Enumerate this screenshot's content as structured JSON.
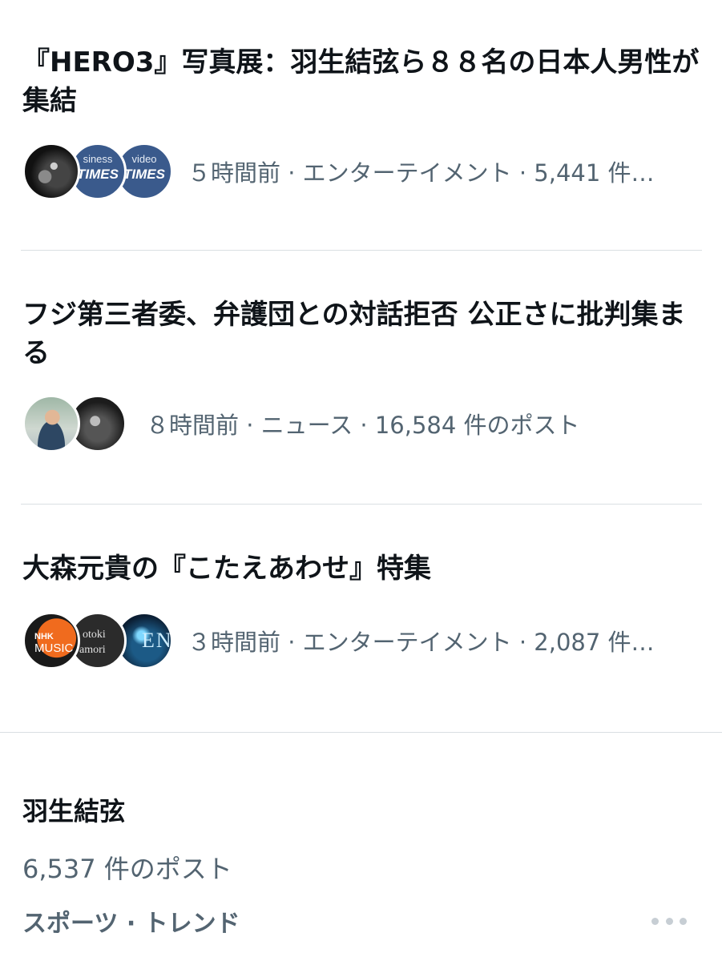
{
  "stories": [
    {
      "title": "『HERO3』写真展：羽生結弦ら８８名の日本人男性が集結",
      "meta": "５時間前 · エンターテイメント · 5,441 件…",
      "avatars": [
        {
          "icon": "photographer-avatar"
        },
        {
          "icon": "business-times-avatar",
          "line1": "siness",
          "line2": "TIMES"
        },
        {
          "icon": "video-times-avatar",
          "line1": "video",
          "line2": "TIMES"
        }
      ]
    },
    {
      "title": "フジ第三者委、弁護団との対話拒否 公正さに批判集まる",
      "meta": "８時間前 · ニュース · 16,584 件のポスト",
      "avatars": [
        {
          "icon": "man-in-suit-avatar"
        },
        {
          "icon": "monochrome-portrait-avatar"
        }
      ]
    },
    {
      "title": "大森元貴の『こたえあわせ』特集",
      "meta": "３時間前 · エンターテイメント · 2,087 件…",
      "avatars": [
        {
          "icon": "nhk-music-avatar",
          "line1": "NHK",
          "line2": "MUSIC"
        },
        {
          "icon": "motoki-omori-avatar",
          "line1": "otoki",
          "line2": "amori"
        },
        {
          "icon": "blue-concert-avatar",
          "line1": "ENI"
        }
      ]
    }
  ],
  "trend": {
    "name": "羽生結弦",
    "post_count": "6,537 件のポスト",
    "context": "スポーツ · トレンド",
    "more_icon": "more-horizontal-icon"
  },
  "colors": {
    "text_primary": "#0f1419",
    "text_secondary": "#536471",
    "divider": "#dadfe3"
  }
}
